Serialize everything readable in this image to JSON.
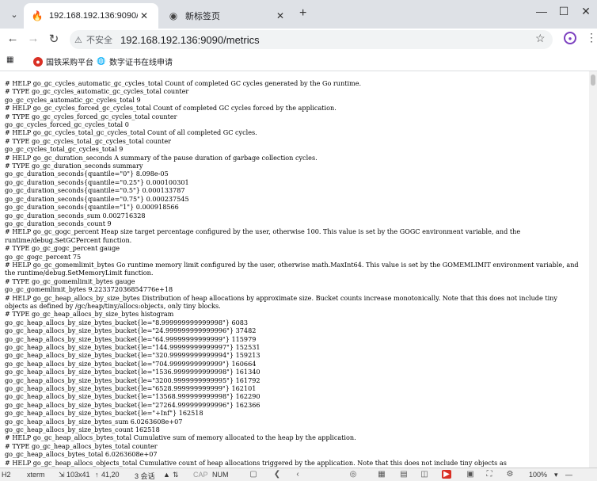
{
  "tabs": [
    {
      "title": "192.168.192.136:9090/metric",
      "icon": "fire-icon"
    },
    {
      "title": "新标签页",
      "icon": "chrome-icon"
    }
  ],
  "address": {
    "security_label": "不安全",
    "url": "192.168.192.136:9090/metrics"
  },
  "bookmarks": [
    {
      "label": "国铁采购平台",
      "icon": "red-circle-icon"
    },
    {
      "label": "数字证书在线申请",
      "icon": "globe-icon"
    }
  ],
  "metrics_text": "# HELP go_gc_cycles_automatic_gc_cycles_total Count of completed GC cycles generated by the Go runtime.\n# TYPE go_gc_cycles_automatic_gc_cycles_total counter\ngo_gc_cycles_automatic_gc_cycles_total 9\n# HELP go_gc_cycles_forced_gc_cycles_total Count of completed GC cycles forced by the application.\n# TYPE go_gc_cycles_forced_gc_cycles_total counter\ngo_gc_cycles_forced_gc_cycles_total 0\n# HELP go_gc_cycles_total_gc_cycles_total Count of all completed GC cycles.\n# TYPE go_gc_cycles_total_gc_cycles_total counter\ngo_gc_cycles_total_gc_cycles_total 9\n# HELP go_gc_duration_seconds A summary of the pause duration of garbage collection cycles.\n# TYPE go_gc_duration_seconds summary\ngo_gc_duration_seconds{quantile=\"0\"} 8.098e-05\ngo_gc_duration_seconds{quantile=\"0.25\"} 0.000100301\ngo_gc_duration_seconds{quantile=\"0.5\"} 0.000133787\ngo_gc_duration_seconds{quantile=\"0.75\"} 0.000237545\ngo_gc_duration_seconds{quantile=\"1\"} 0.000918566\ngo_gc_duration_seconds_sum 0.002716328\ngo_gc_duration_seconds_count 9\n# HELP go_gc_gogc_percent Heap size target percentage configured by the user, otherwise 100. This value is set by the GOGC environment variable, and the runtime/debug.SetGCPercent function.\n# TYPE go_gc_gogc_percent gauge\ngo_gc_gogc_percent 75\n# HELP go_gc_gomemlimit_bytes Go runtime memory limit configured by the user, otherwise math.MaxInt64. This value is set by the GOMEMLIMIT environment variable, and the runtime/debug.SetMemoryLimit function.\n# TYPE go_gc_gomemlimit_bytes gauge\ngo_gc_gomemlimit_bytes 9.223372036854776e+18\n# HELP go_gc_heap_allocs_by_size_bytes Distribution of heap allocations by approximate size. Bucket counts increase monotonically. Note that this does not include tiny objects as defined by /gc/heap/tiny/allocs:objects, only tiny blocks.\n# TYPE go_gc_heap_allocs_by_size_bytes histogram\ngo_gc_heap_allocs_by_size_bytes_bucket{le=\"8.999999999999998\"} 6083\ngo_gc_heap_allocs_by_size_bytes_bucket{le=\"24.999999999999996\"} 37482\ngo_gc_heap_allocs_by_size_bytes_bucket{le=\"64.99999999999999\"} 115979\ngo_gc_heap_allocs_by_size_bytes_bucket{le=\"144.99999999999997\"} 152531\ngo_gc_heap_allocs_by_size_bytes_bucket{le=\"320.99999999999994\"} 159213\ngo_gc_heap_allocs_by_size_bytes_bucket{le=\"704.9999999999999\"} 160664\ngo_gc_heap_allocs_by_size_bytes_bucket{le=\"1536.9999999999998\"} 161340\ngo_gc_heap_allocs_by_size_bytes_bucket{le=\"3200.9999999999995\"} 161792\ngo_gc_heap_allocs_by_size_bytes_bucket{le=\"6528.999999999999\"} 162101\ngo_gc_heap_allocs_by_size_bytes_bucket{le=\"13568.999999999998\"} 162290\ngo_gc_heap_allocs_by_size_bytes_bucket{le=\"27264.999999999996\"} 162366\ngo_gc_heap_allocs_by_size_bytes_bucket{le=\"+Inf\"} 162518\ngo_gc_heap_allocs_by_size_bytes_sum 6.0263608e+07\ngo_gc_heap_allocs_by_size_bytes_count 162518\n# HELP go_gc_heap_allocs_bytes_total Cumulative sum of memory allocated to the heap by the application.\n# TYPE go_gc_heap_allocs_bytes_total counter\ngo_gc_heap_allocs_bytes_total 6.0263608e+07\n# HELP go_gc_heap_allocs_objects_total Cumulative count of heap allocations triggered by the application. Note that this does not include tiny objects as",
  "taskbar": {
    "left": "H2",
    "app": "xterm",
    "size": "103x41",
    "pos": "41,20",
    "session": "3 会话",
    "cap": "CAP",
    "num": "NUM",
    "zoom": "100%"
  }
}
